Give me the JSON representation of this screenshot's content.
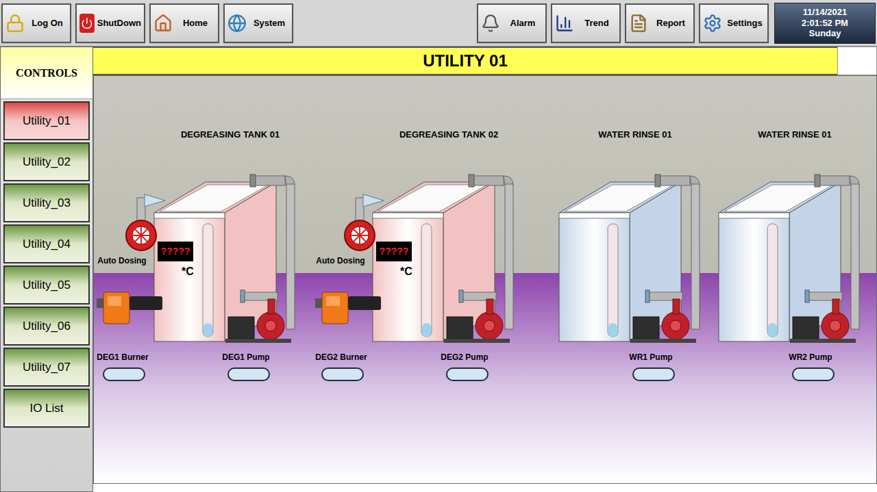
{
  "top_bar": {
    "left_buttons": [
      {
        "label": "Log On"
      },
      {
        "label": "ShutDown"
      },
      {
        "label": "Home"
      },
      {
        "label": "System"
      }
    ],
    "right_buttons": [
      {
        "label": "Alarm"
      },
      {
        "label": "Trend"
      },
      {
        "label": "Report"
      },
      {
        "label": "Settings"
      }
    ],
    "clock": {
      "date": "11/14/2021",
      "time": "2:01:52 PM",
      "day": "Sunday"
    }
  },
  "sidebar": {
    "title": "CONTROLS",
    "items": [
      {
        "label": "Utility_01",
        "selected": true
      },
      {
        "label": "Utility_02",
        "selected": false
      },
      {
        "label": "Utility_03",
        "selected": false
      },
      {
        "label": "Utility_04",
        "selected": false
      },
      {
        "label": "Utility_05",
        "selected": false
      },
      {
        "label": "Utility_06",
        "selected": false
      },
      {
        "label": "Utility_07",
        "selected": false
      },
      {
        "label": "IO List",
        "selected": false
      }
    ]
  },
  "page_title": "UTILITY 01",
  "tanks": [
    {
      "title": "DEGREASING TANK 01",
      "kind": "degreasing",
      "color": "#f2c2c2",
      "level": 0.12,
      "dosing_label": "Auto Dosing",
      "temperature": "?????",
      "unit": "*C",
      "burner_label": "DEG1 Burner",
      "pump_label": "DEG1 Pump"
    },
    {
      "title": "DEGREASING TANK 02",
      "kind": "degreasing",
      "color": "#f2c2c2",
      "level": 0.12,
      "dosing_label": "Auto Dosing",
      "temperature": "?????",
      "unit": "*C",
      "burner_label": "DEG2 Burner",
      "pump_label": "DEG2 Pump"
    },
    {
      "title": "WATER RINSE 01",
      "kind": "rinse",
      "color": "#c4d4e8",
      "level": 0.12,
      "pump_label": "WR1 Pump"
    },
    {
      "title": "WATER RINSE 01",
      "kind": "rinse",
      "color": "#c4d4e8",
      "level": 0.12,
      "pump_label": "WR2 Pump"
    }
  ]
}
